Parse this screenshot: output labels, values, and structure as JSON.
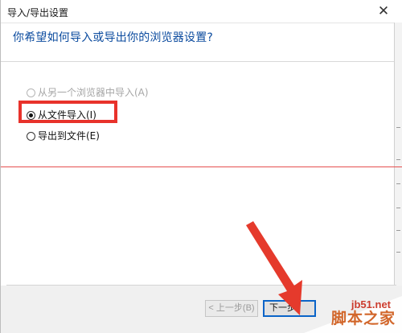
{
  "window": {
    "title": "导入/导出设置",
    "close_glyph": "✕"
  },
  "heading": "你希望如何导入或导出你的浏览器设置?",
  "options": [
    {
      "label": "从另一个浏览器中导入(A)",
      "checked": false,
      "enabled": false
    },
    {
      "label": "从文件导入(I)",
      "checked": true,
      "enabled": true
    },
    {
      "label": "导出到文件(E)",
      "checked": false,
      "enabled": true
    }
  ],
  "buttons": {
    "prev": "< 上一步(B)",
    "next": "下一步("
  },
  "watermark": {
    "url": "jb51.net",
    "name": "脚本之家"
  },
  "colors": {
    "heading": "#0a4a9e",
    "highlight": "#e8322b",
    "arrow": "#e53a2c"
  }
}
